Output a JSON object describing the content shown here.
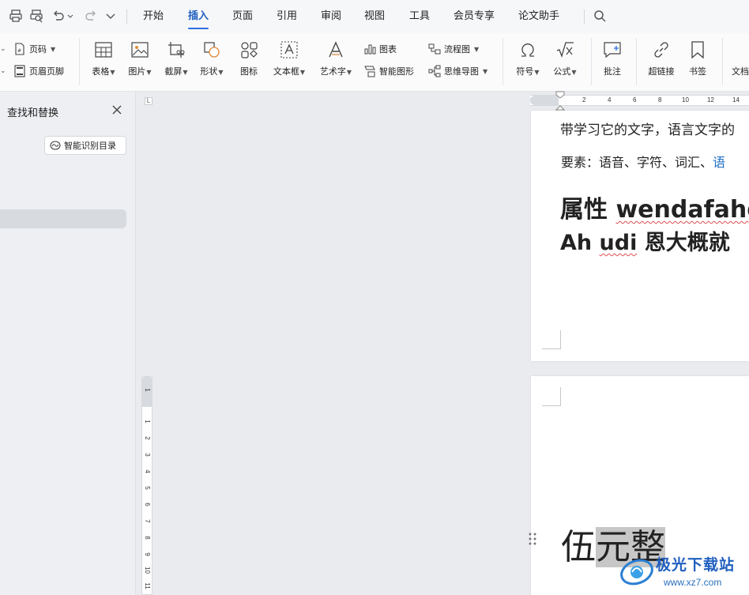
{
  "menu": {
    "tabs": [
      "开始",
      "插入",
      "页面",
      "引用",
      "审阅",
      "视图",
      "工具",
      "会员专享",
      "论文助手"
    ],
    "active_tab": "插入"
  },
  "ribbon": {
    "page_number": "页码",
    "header_footer": "页眉页脚",
    "table": "表格",
    "picture": "图片",
    "screenshot": "截屏",
    "shape": "形状",
    "icon": "图标",
    "textbox": "文本框",
    "wordart": "艺术字",
    "chart": "图表",
    "smartart": "智能图形",
    "flowchart": "流程图",
    "mindmap": "思维导图",
    "symbol": "符号",
    "formula": "公式",
    "comment": "批注",
    "hyperlink": "超链接",
    "bookmark": "书签",
    "document_part": "文档"
  },
  "left_pane": {
    "title": "查找和替换",
    "smart_toc_button": "智能识别目录"
  },
  "horizontal_ruler": [
    "2",
    "4",
    "6",
    "8",
    "10",
    "12",
    "14"
  ],
  "vertical_ruler": [
    "1",
    "1",
    "2",
    "3",
    "4",
    "5",
    "6",
    "7",
    "8",
    "9",
    "10",
    "11"
  ],
  "document": {
    "page1_line1": "带学习它的文字，语言文字的",
    "page1_line2_a": "要素：语音、字符、词汇、",
    "page1_line2_b": "语",
    "page1_heading1_a": "属性 ",
    "page1_heading1_b": "wendafahg",
    "page1_heading2_a": "Ah ",
    "page1_heading2_b": "udi",
    "page1_heading2_c": " 恩大概就",
    "page2_text_a": "伍",
    "page2_text_b": "元整"
  },
  "watermark": {
    "name": "极光下载站",
    "url": "www.xz7.com"
  },
  "colors": {
    "accent": "#2b6de0",
    "selection": "#c7c7c7",
    "watermark_blue": "#1f5fbf"
  }
}
